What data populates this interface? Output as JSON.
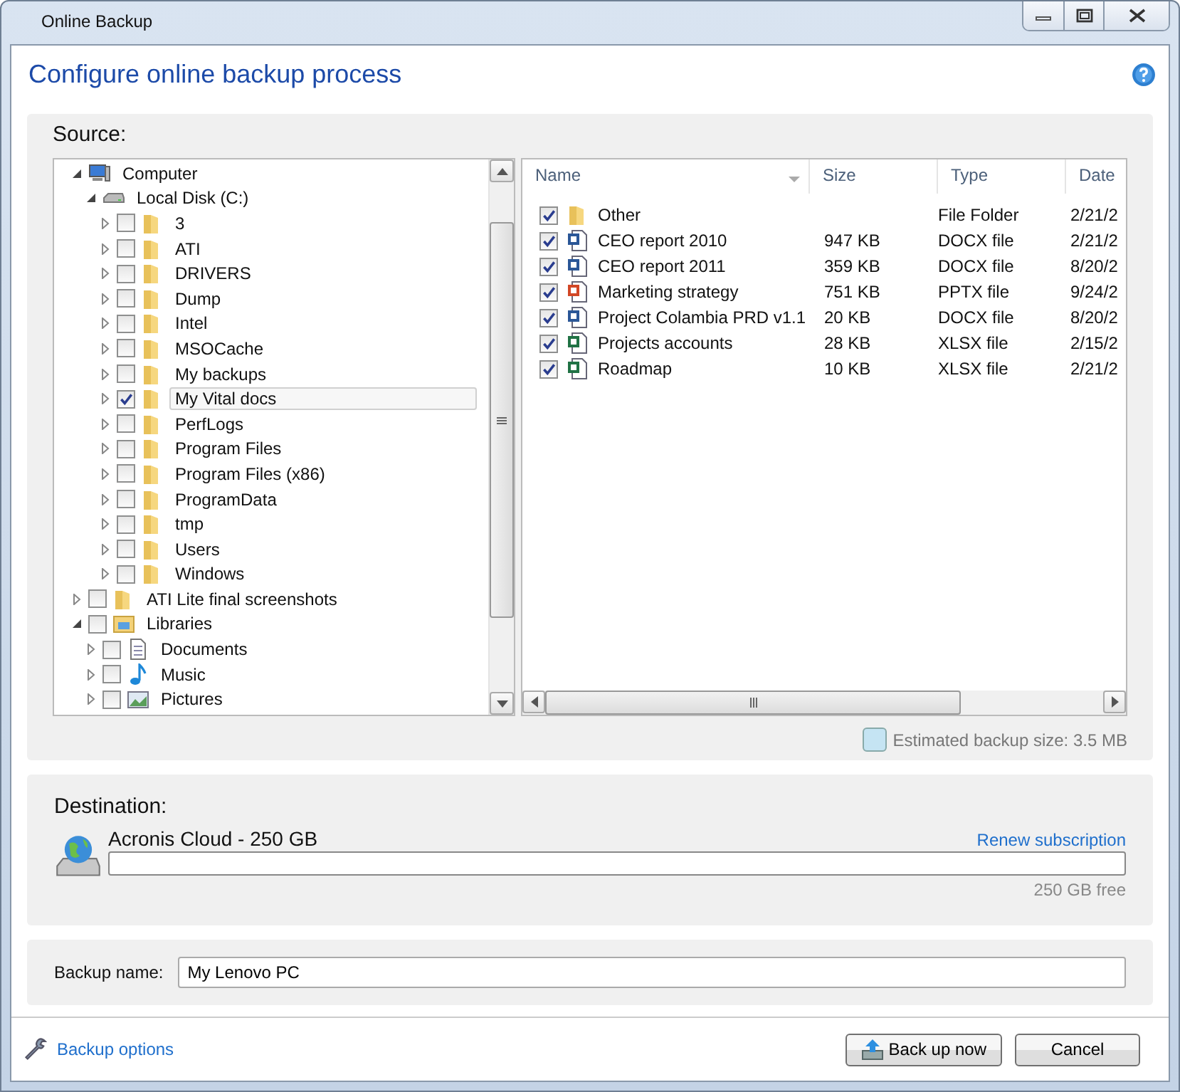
{
  "window": {
    "title": "Online Backup"
  },
  "header": {
    "title": "Configure online backup process"
  },
  "source": {
    "label": "Source:",
    "tree": [
      {
        "label": "Computer",
        "kind": "computer",
        "expanded": true,
        "selected": false,
        "children": [
          {
            "label": "Local Disk (C:)",
            "kind": "disk",
            "expanded": true,
            "selected": false,
            "children": [
              {
                "label": "3",
                "kind": "folder",
                "expanded": false,
                "checked": false,
                "selected": false
              },
              {
                "label": "ATI",
                "kind": "folder",
                "expanded": false,
                "checked": false,
                "selected": false
              },
              {
                "label": "DRIVERS",
                "kind": "folder",
                "expanded": false,
                "checked": false,
                "selected": false
              },
              {
                "label": "Dump",
                "kind": "folder",
                "expanded": false,
                "checked": false,
                "selected": false
              },
              {
                "label": "Intel",
                "kind": "folder",
                "expanded": false,
                "checked": false,
                "selected": false
              },
              {
                "label": "MSOCache",
                "kind": "folder",
                "expanded": false,
                "checked": false,
                "selected": false
              },
              {
                "label": "My backups",
                "kind": "folder",
                "expanded": false,
                "checked": false,
                "selected": false
              },
              {
                "label": "My Vital docs",
                "kind": "folder",
                "expanded": false,
                "checked": true,
                "selected": true
              },
              {
                "label": "PerfLogs",
                "kind": "folder",
                "expanded": false,
                "checked": false,
                "selected": false
              },
              {
                "label": "Program Files",
                "kind": "folder",
                "expanded": false,
                "checked": false,
                "selected": false
              },
              {
                "label": "Program Files (x86)",
                "kind": "folder",
                "expanded": false,
                "checked": false,
                "selected": false
              },
              {
                "label": "ProgramData",
                "kind": "folder",
                "expanded": false,
                "checked": false,
                "selected": false
              },
              {
                "label": "tmp",
                "kind": "folder",
                "expanded": false,
                "checked": false,
                "selected": false
              },
              {
                "label": "Users",
                "kind": "folder",
                "expanded": false,
                "checked": false,
                "selected": false
              },
              {
                "label": "Windows",
                "kind": "folder",
                "expanded": false,
                "checked": false,
                "selected": false
              }
            ]
          }
        ]
      },
      {
        "label": "ATI Lite final screenshots",
        "kind": "folder",
        "expanded": false,
        "checked": false,
        "selected": false
      },
      {
        "label": "Libraries",
        "kind": "library",
        "expanded": true,
        "checked": false,
        "selected": false,
        "children": [
          {
            "label": "Documents",
            "kind": "document",
            "expanded": false,
            "checked": false,
            "selected": false
          },
          {
            "label": "Music",
            "kind": "music",
            "expanded": false,
            "checked": false,
            "selected": false
          },
          {
            "label": "Pictures",
            "kind": "pictures",
            "expanded": false,
            "checked": false,
            "selected": false
          }
        ]
      }
    ],
    "columns": [
      "Name",
      "Size",
      "Type",
      "Date"
    ],
    "files": [
      {
        "name": "Other",
        "kind": "folder",
        "checked": true,
        "type": "File Folder",
        "date": "2/21/2"
      },
      {
        "name": "CEO report 2010",
        "kind": "word",
        "checked": true,
        "size": "947 KB",
        "type": "DOCX file",
        "date": "2/21/2"
      },
      {
        "name": "CEO report 2011",
        "kind": "word",
        "checked": true,
        "size": "359 KB",
        "type": "DOCX file",
        "date": "8/20/2"
      },
      {
        "name": "Marketing strategy",
        "kind": "powerpoint",
        "checked": true,
        "size": "751 KB",
        "type": "PPTX file",
        "date": "9/24/2"
      },
      {
        "name": "Project Colambia PRD v1.1",
        "kind": "word",
        "checked": true,
        "size": "20 KB",
        "type": "DOCX file",
        "date": "8/20/2"
      },
      {
        "name": "Projects accounts",
        "kind": "excel",
        "checked": true,
        "size": "28 KB",
        "type": "XLSX file",
        "date": "2/15/2"
      },
      {
        "name": "Roadmap",
        "kind": "excel",
        "checked": true,
        "size": "10 KB",
        "type": "XLSX file",
        "date": "2/21/2"
      }
    ],
    "estimate": "Estimated backup size: 3.5 MB"
  },
  "destination": {
    "label": "Destination:",
    "name": "Acronis Cloud - 250 GB",
    "link": "Renew subscription",
    "level": 0,
    "free": "250 GB free"
  },
  "backup_name": {
    "label": "Backup name:",
    "value": "My Lenovo PC"
  },
  "footer": {
    "options": "Backup options",
    "buttons": [
      "Back up now",
      "Cancel"
    ]
  }
}
